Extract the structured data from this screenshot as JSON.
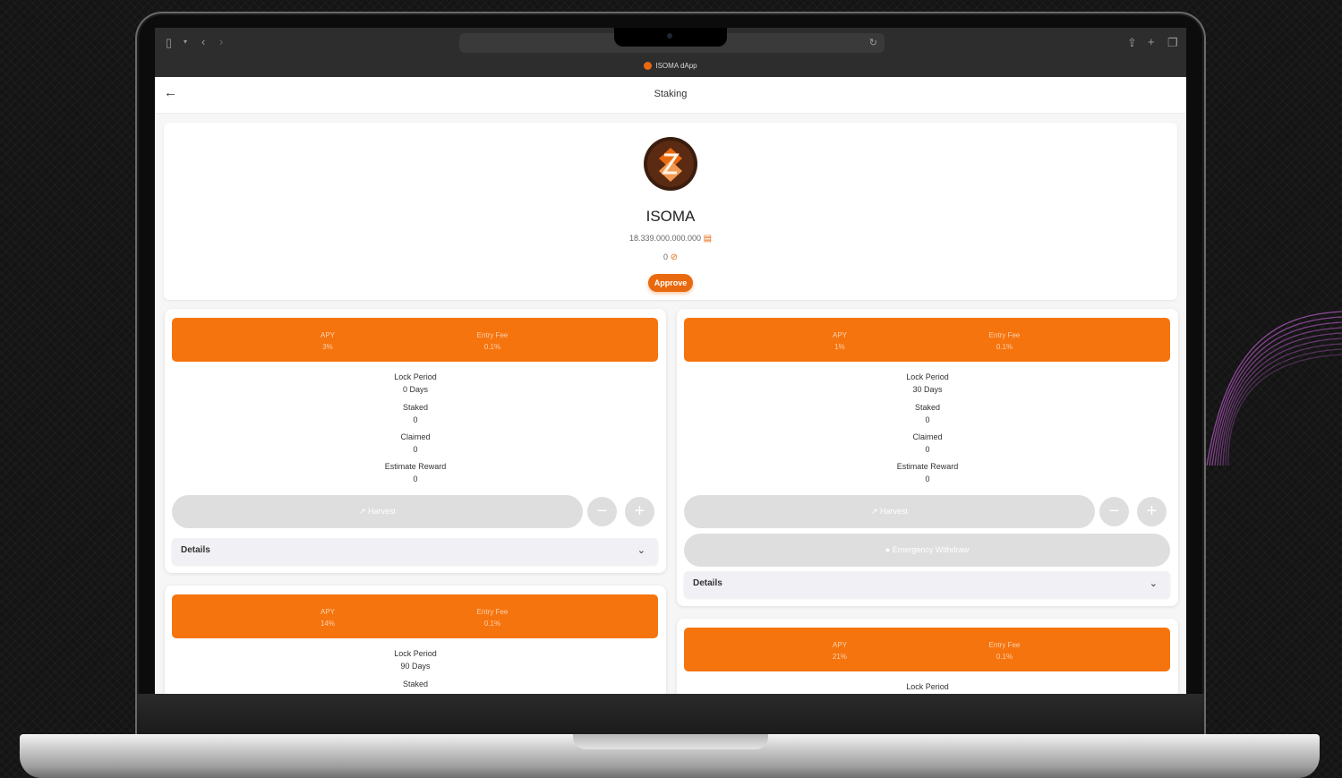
{
  "browser": {
    "tab_title": "ISOMA dApp",
    "icons": {
      "sidebar": "sidebar-icon",
      "back": "chevron-left-icon",
      "forward": "chevron-right-icon",
      "reload": "reload-icon",
      "share": "share-icon",
      "new_tab": "plus-icon",
      "tabs": "tabs-icon"
    }
  },
  "header": {
    "title": "Staking",
    "back_icon": "arrow-left-icon"
  },
  "token": {
    "name": "ISOMA",
    "supply": "18.339.000.000.000",
    "balance": "0",
    "approve_label": "Approve"
  },
  "labels": {
    "apy": "APY",
    "entry_fee": "Entry Fee",
    "lock_period": "Lock Period",
    "staked": "Staked",
    "claimed": "Claimed",
    "estimate_reward": "Estimate Reward",
    "harvest": "Harvest",
    "emergency_withdraw": "Emergency Withdraw",
    "details": "Details",
    "minus": "−",
    "plus": "+"
  },
  "pools": [
    {
      "apy": "3%",
      "entry_fee": "0.1%",
      "lock_period": "0 Days",
      "staked": "0",
      "claimed": "0",
      "estimate_reward": "0"
    },
    {
      "apy": "1%",
      "entry_fee": "0.1%",
      "lock_period": "30 Days",
      "staked": "0",
      "claimed": "0",
      "estimate_reward": "0"
    },
    {
      "apy": "14%",
      "entry_fee": "0.1%",
      "lock_period": "90 Days"
    },
    {
      "apy": "21%",
      "entry_fee": "0.1%"
    }
  ],
  "colors": {
    "accent": "#f5740e",
    "disabled": "#dedede",
    "swoosh": "#9b4fa8"
  }
}
